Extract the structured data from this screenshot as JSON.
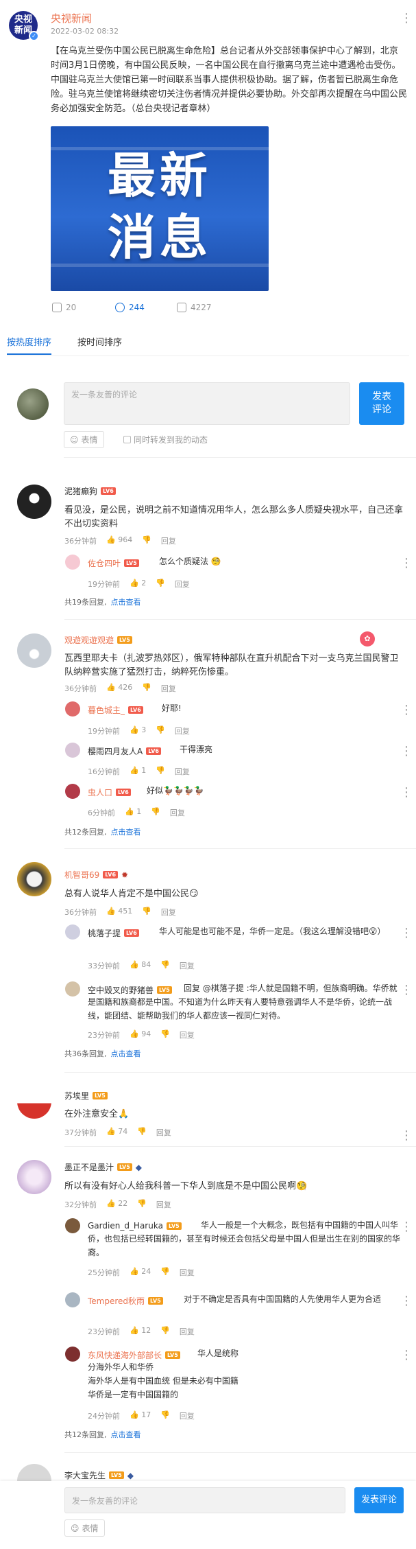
{
  "post": {
    "author": "央视新闻",
    "avatar_text": "央视新闻",
    "date": "2022-03-02 08:32",
    "headline": "【在乌克兰受伤中国公民已脱离生命危险】",
    "body": "总台记者从外交部领事保护中心了解到，北京时间3月1日傍晚，有中国公民反映，一名中国公民在自行撤离乌克兰途中遭遇枪击受伤。中国驻乌克兰大使馆已第一时间联系当事人提供积极协助。据了解，伤者暂已脱离生命危险。驻乌克兰使馆将继续密切关注伤者情况并提供必要协助。外交部再次提醒在乌中国公民务必加强安全防范。（总台央视记者章林）",
    "image_text_1": "最新",
    "image_text_2": "消息",
    "image_color": "#1b53b7",
    "reposts": "20",
    "comments": "244",
    "likes": "4227"
  },
  "tabs": {
    "hot": "按热度排序",
    "time": "按时间排序"
  },
  "composer": {
    "placeholder": "发一条友善的评论",
    "send": "发表\n评论",
    "send_bottom": "发表评论",
    "emoji": "表情",
    "sync": "同时转发到我的动态"
  },
  "accent": "#1a72d9",
  "comments": [
    {
      "user": "泥猪癫狗",
      "level": "LV6",
      "text": "看见没，是公民，说明之前不知道情况用华人，怎么那么多人质疑央视水平，自己还拿不出切实资料",
      "time": "36分钟前",
      "likes": "964",
      "reply": "回复",
      "replies": [
        {
          "user": "佐仓四叶",
          "level": "LV5",
          "text": "怎么个质疑法 🧐",
          "time": "19分钟前",
          "likes": "2"
        }
      ],
      "footer_count": "共19条回复,",
      "footer_link": "点击查看"
    },
    {
      "user": "观遊观遊观遊",
      "level": "LV5",
      "text": "瓦西里耶夫卡（扎波罗热郊区），俄军特种部队在直升机配合下对一支乌克兰国民警卫队纳粹营实施了猛烈打击，纳粹死伤惨重。",
      "time": "36分钟前",
      "likes": "426",
      "reply": "回复",
      "replies": [
        {
          "user": "暮色城主_",
          "level": "LV6",
          "text": "好耶!",
          "time": "19分钟前",
          "likes": "3"
        },
        {
          "user": "樱雨四月友人A",
          "level": "LV6",
          "text": "干得漂亮",
          "time": "16分钟前",
          "likes": "1"
        },
        {
          "user": "虫人口",
          "level": "LV6",
          "text": "好似🦆🦆🦆🦆",
          "time": "6分钟前",
          "likes": "1"
        }
      ],
      "footer_count": "共12条回复,",
      "footer_link": "点击查看"
    },
    {
      "user": "机智哥69",
      "level": "LV6",
      "text": "总有人说华人肯定不是中国公民😏",
      "time": "36分钟前",
      "likes": "451",
      "reply": "回复",
      "replies": [
        {
          "user": "桃落子提",
          "level": "LV6",
          "text": "华人可能是也可能不是，华侨一定是。（我这么理解没错吧😮）",
          "time": "33分钟前",
          "likes": "84"
        },
        {
          "user": "空中毁叉的野猪兽",
          "level": "LV5",
          "mention": "@棋落子提",
          "text": "回复 @棋落子提 :华人就是国籍不明，但族裔明确。华侨就是国籍和族裔都是中国。不知道为什么昨天有人要特意强调华人不是华侨，论统一战线，能团结、能帮助我们的华人都应该一视同仁对待。",
          "time": "23分钟前",
          "likes": "94"
        }
      ],
      "footer_count": "共36条回复,",
      "footer_link": "点击查看"
    },
    {
      "user": "苏埃里",
      "level": "LV5",
      "text": "在外注意安全🙏",
      "time": "37分钟前",
      "likes": "74",
      "reply": "回复"
    },
    {
      "user": "墨正不是墨汁",
      "level": "LV5",
      "text": "所以有没有好心人给我科普一下华人到底是不是中国公民啊🧐",
      "time": "32分钟前",
      "likes": "22",
      "reply": "回复",
      "replies": [
        {
          "user": "Gardien_d_Haruka",
          "level": "LV5",
          "text": "华人一般是一个大概念，既包括有中国籍的中国人叫华侨，也包括已经转国籍的，甚至有时候还会包括父母是中国人但是出生在别的国家的华裔。",
          "time": "25分钟前",
          "likes": "24"
        },
        {
          "user": "Tempered秋雨",
          "level": "LV5",
          "text": "对于不确定是否具有中国国籍的人先使用华人更为合适",
          "time": "23分钟前",
          "likes": "12"
        },
        {
          "user": "东风快递海外部部长",
          "level": "LV5",
          "text": "华人是统称\n分海外华人和华侨\n海外华人是有中国血统 但是未必有中国籍\n华侨是一定有中国国籍的",
          "time": "24分钟前",
          "likes": "17"
        }
      ],
      "footer_count": "共12条回复,",
      "footer_link": "点击查看"
    },
    {
      "user": "李大宝先生",
      "level": "LV5"
    }
  ]
}
